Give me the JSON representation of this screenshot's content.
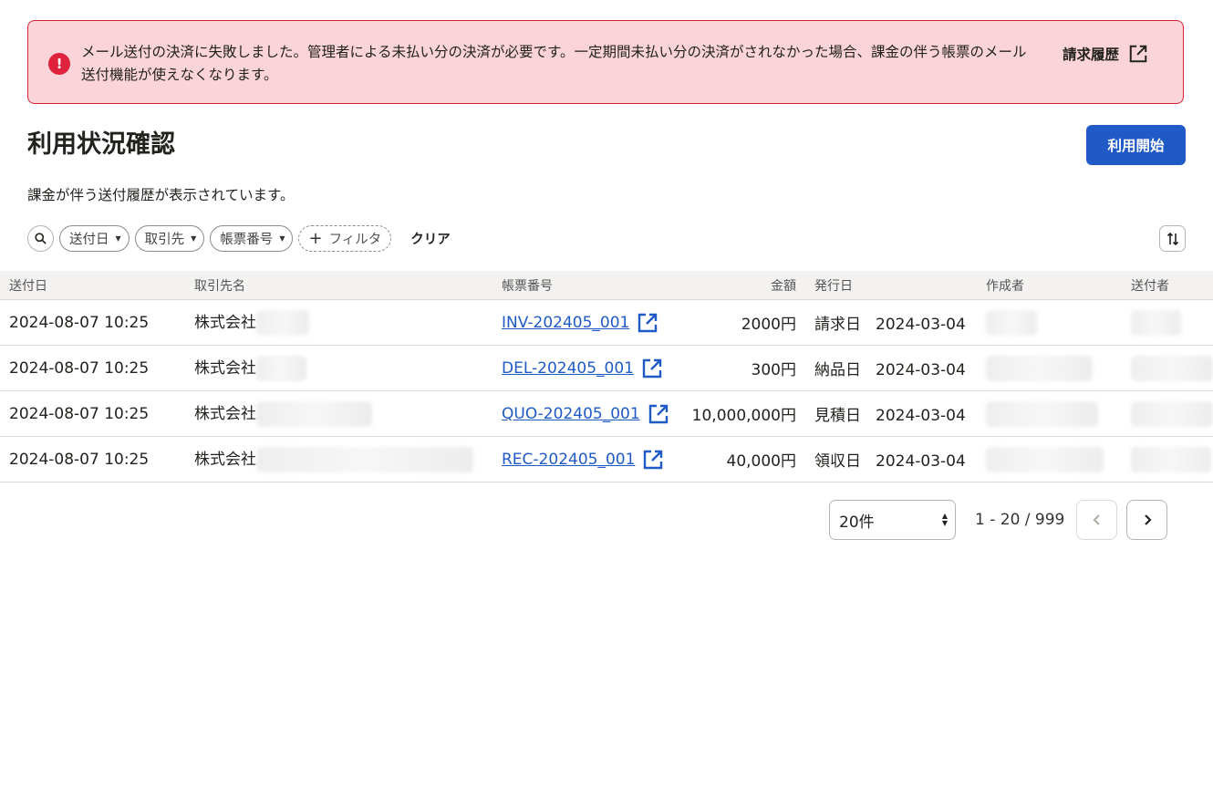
{
  "alert": {
    "message": "メール送付の決済に失敗しました。管理者による未払い分の決済が必要です。一定期間未払い分の決済がされなかった場合、課金の伴う帳票のメール送付機能が使えなくなります。",
    "link_label": "請求履歴",
    "icon_text": "!",
    "color": "#e0233c"
  },
  "page": {
    "title": "利用状況確認",
    "primary_button": "利用開始",
    "description": "課金が伴う送付履歴が表示されています。",
    "accent_color": "#1f5ac7"
  },
  "filters": {
    "chips": [
      "送付日",
      "取引先",
      "帳票番号"
    ],
    "add_filter": "フィルタ",
    "clear": "クリア"
  },
  "table": {
    "columns": [
      "送付日",
      "取引先名",
      "帳票番号",
      "金額",
      "発行日",
      "作成者",
      "送付者"
    ],
    "rows": [
      {
        "sent_at": "2024-08-07 10:25",
        "client_prefix": "株式会社",
        "doc_no": "INV-202405_001",
        "amount": "2000円",
        "date_type": "請求日",
        "date": "2024-03-04"
      },
      {
        "sent_at": "2024-08-07 10:25",
        "client_prefix": "株式会社",
        "doc_no": "DEL-202405_001",
        "amount": "300円",
        "date_type": "納品日",
        "date": "2024-03-04"
      },
      {
        "sent_at": "2024-08-07 10:25",
        "client_prefix": "株式会社",
        "doc_no": "QUO-202405_001",
        "amount": "10,000,000円",
        "date_type": "見積日",
        "date": "2024-03-04"
      },
      {
        "sent_at": "2024-08-07 10:25",
        "client_prefix": "株式会社",
        "doc_no": "REC-202405_001",
        "amount": "40,000円",
        "date_type": "領収日",
        "date": "2024-03-04"
      }
    ]
  },
  "pagination": {
    "page_size": "20件",
    "range": "1 - 20 / 999"
  }
}
